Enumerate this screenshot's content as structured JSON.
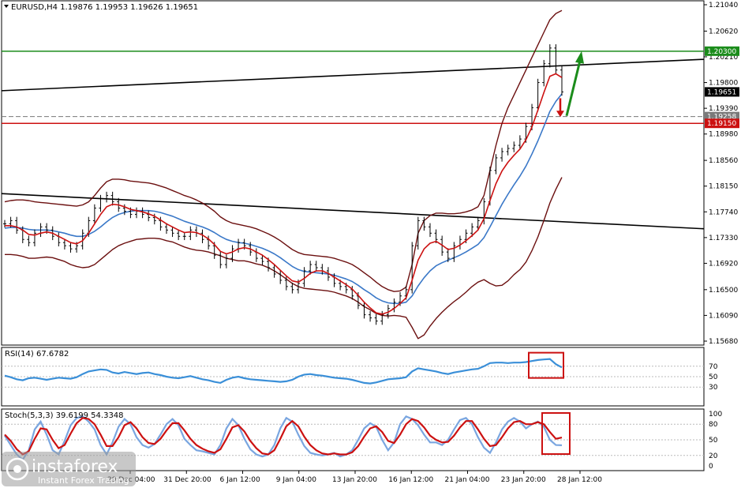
{
  "window": {
    "header": "EURUSD,H4  1.19876 1.19953 1.19626 1.19651",
    "rsi_label": "RSI(14) 67.6782",
    "stoch_label": "Stoch(5,3,3) 39.6199 54.3348"
  },
  "logo": {
    "brand": "instaforex",
    "tagline": "Instant Forex Trading"
  },
  "chart_data": [
    {
      "type": "line",
      "title": "EURUSD,H4  1.19876 1.19953 1.19626 1.19651",
      "y_ticks": [
        "1.21040",
        "1.20620",
        "1.20210",
        "1.19800",
        "1.19390",
        "1.18980",
        "1.18560",
        "1.18150",
        "1.17740",
        "1.17330",
        "1.16920",
        "1.16500",
        "1.16090",
        "1.15680"
      ],
      "ylim": [
        1.1568,
        1.2104
      ],
      "x_ticks": [
        "29 Dec 04:00",
        "31 Dec 20:00",
        "6 Jan 12:00",
        "9 Jan 04:00",
        "13 Jan 20:00",
        "16 Jan 12:00",
        "21 Jan 04:00",
        "23 Jan 20:00",
        "28 Jan 12:00"
      ],
      "price_tags": [
        {
          "label": "1.20300",
          "value": 1.203,
          "color": "#1b8c1b"
        },
        {
          "label": "1.19651",
          "value": 1.19651,
          "color": "#000000"
        },
        {
          "label": "1.19258",
          "value": 1.19258,
          "color": "#7a7a7a"
        },
        {
          "label": "1.19150",
          "value": 1.1915,
          "color": "#cc1111"
        }
      ],
      "levels": {
        "green": 1.203,
        "red": 1.1915,
        "gray_dashed": 1.19258
      },
      "trendlines": [
        {
          "from": [
            0,
            1.1967
          ],
          "to": [
            1,
            1.2017
          ]
        },
        {
          "from": [
            0,
            1.1803
          ],
          "to": [
            1,
            1.1747
          ]
        }
      ],
      "colors": {
        "price": "#000000",
        "ma_fast": "#cc1111",
        "ma_slow": "#3a78c8",
        "bands": "#6b0f0f",
        "green_arrow": "#1b8c1b",
        "red_arrow": "#cc1111"
      },
      "series": [
        {
          "values": [
            1.1755,
            1.176,
            1.1745,
            1.173,
            1.1725,
            1.174,
            1.175,
            1.1745,
            1.1735,
            1.1725,
            1.172,
            1.1715,
            1.172,
            1.174,
            1.176,
            1.178,
            1.1795,
            1.18,
            1.179,
            1.178,
            1.1775,
            1.177,
            1.1775,
            1.177,
            1.1765,
            1.176,
            1.175,
            1.1745,
            1.174,
            1.1735,
            1.1735,
            1.1745,
            1.174,
            1.173,
            1.172,
            1.1705,
            1.169,
            1.17,
            1.1715,
            1.1725,
            1.172,
            1.171,
            1.17,
            1.1695,
            1.1685,
            1.1675,
            1.1665,
            1.1655,
            1.165,
            1.166,
            1.168,
            1.169,
            1.1685,
            1.168,
            1.167,
            1.166,
            1.1655,
            1.165,
            1.164,
            1.1625,
            1.161,
            1.1605,
            1.16,
            1.161,
            1.162,
            1.163,
            1.164,
            1.165,
            1.172,
            1.176,
            1.175,
            1.174,
            1.173,
            1.171,
            1.17,
            1.172,
            1.173,
            1.174,
            1.175,
            1.176,
            1.179,
            1.184,
            1.186,
            1.187,
            1.1875,
            1.188,
            1.189,
            1.191,
            1.194,
            1.198,
            1.201,
            1.2035,
            1.2,
            1.19651
          ]
        },
        {
          "values": [
            1.1752,
            1.1752,
            1.175,
            1.1745,
            1.1738,
            1.1737,
            1.174,
            1.1742,
            1.174,
            1.1735,
            1.173,
            1.1725,
            1.1723,
            1.1728,
            1.174,
            1.1755,
            1.177,
            1.1782,
            1.1786,
            1.1785,
            1.1782,
            1.1778,
            1.1776,
            1.1774,
            1.1771,
            1.1767,
            1.1761,
            1.1755,
            1.175,
            1.1745,
            1.1741,
            1.1742,
            1.1741,
            1.1737,
            1.1731,
            1.1722,
            1.1711,
            1.1707,
            1.171,
            1.1715,
            1.1717,
            1.1715,
            1.171,
            1.1705,
            1.1698,
            1.169,
            1.1681,
            1.1672,
            1.1664,
            1.1662,
            1.1668,
            1.1676,
            1.168,
            1.168,
            1.1676,
            1.167,
            1.1664,
            1.1658,
            1.1651,
            1.1641,
            1.163,
            1.1621,
            1.1613,
            1.1611,
            1.1614,
            1.162,
            1.1628,
            1.1637,
            1.1665,
            1.1697,
            1.1715,
            1.1724,
            1.1727,
            1.1721,
            1.1714,
            1.1716,
            1.1721,
            1.1728,
            1.1736,
            1.1745,
            1.1763,
            1.1792,
            1.1819,
            1.1839,
            1.1853,
            1.1864,
            1.1874,
            1.1889,
            1.1909,
            1.1936,
            1.1964,
            1.199,
            1.1994,
            1.1988
          ]
        },
        {
          "values": [
            1.1748,
            1.1749,
            1.1749,
            1.1748,
            1.1746,
            1.1745,
            1.1745,
            1.1745,
            1.1744,
            1.1742,
            1.174,
            1.1737,
            1.1735,
            1.1735,
            1.1738,
            1.1743,
            1.175,
            1.1758,
            1.1765,
            1.177,
            1.1773,
            1.1775,
            1.1776,
            1.1776,
            1.1776,
            1.1775,
            1.1773,
            1.177,
            1.1767,
            1.1763,
            1.1759,
            1.1756,
            1.1753,
            1.175,
            1.1746,
            1.1741,
            1.1735,
            1.173,
            1.1727,
            1.1725,
            1.1724,
            1.1722,
            1.1719,
            1.1716,
            1.1712,
            1.1707,
            1.1701,
            1.1694,
            1.1687,
            1.1682,
            1.1679,
            1.1678,
            1.1677,
            1.1676,
            1.1675,
            1.1673,
            1.167,
            1.1667,
            1.1663,
            1.1657,
            1.165,
            1.1644,
            1.1637,
            1.1632,
            1.1629,
            1.1628,
            1.1628,
            1.163,
            1.164,
            1.1656,
            1.1669,
            1.168,
            1.1688,
            1.1693,
            1.1697,
            1.1701,
            1.1705,
            1.171,
            1.1716,
            1.1722,
            1.1733,
            1.175,
            1.1768,
            1.1786,
            1.1802,
            1.1817,
            1.1831,
            1.1847,
            1.1866,
            1.1887,
            1.191,
            1.1934,
            1.195,
            1.1962
          ]
        },
        {
          "values": [
            1.179,
            1.1792,
            1.1793,
            1.1793,
            1.1792,
            1.179,
            1.1789,
            1.1788,
            1.1787,
            1.1786,
            1.1785,
            1.1784,
            1.1783,
            1.1785,
            1.179,
            1.18,
            1.1812,
            1.1822,
            1.1826,
            1.1826,
            1.1825,
            1.1823,
            1.1822,
            1.1821,
            1.182,
            1.1818,
            1.1815,
            1.1812,
            1.1808,
            1.1804,
            1.18,
            1.1797,
            1.1793,
            1.1788,
            1.1782,
            1.1775,
            1.1766,
            1.176,
            1.1756,
            1.1754,
            1.1752,
            1.175,
            1.1747,
            1.1743,
            1.1739,
            1.1734,
            1.1728,
            1.1721,
            1.1714,
            1.1709,
            1.1706,
            1.1705,
            1.1704,
            1.1703,
            1.1702,
            1.17,
            1.1697,
            1.1694,
            1.169,
            1.1684,
            1.1677,
            1.167,
            1.1662,
            1.1655,
            1.165,
            1.1647,
            1.1648,
            1.1654,
            1.169,
            1.174,
            1.176,
            1.1768,
            1.1772,
            1.1772,
            1.1771,
            1.1771,
            1.1772,
            1.1774,
            1.1777,
            1.1782,
            1.18,
            1.184,
            1.188,
            1.1915,
            1.194,
            1.196,
            1.198,
            1.2,
            1.202,
            1.204,
            1.206,
            1.208,
            1.209,
            1.2095
          ]
        },
        {
          "values": [
            1.1706,
            1.1706,
            1.1705,
            1.1703,
            1.17,
            1.17,
            1.1701,
            1.1702,
            1.1701,
            1.1698,
            1.1695,
            1.169,
            1.1687,
            1.1685,
            1.1686,
            1.169,
            1.1698,
            1.1706,
            1.1714,
            1.172,
            1.1724,
            1.1727,
            1.173,
            1.1731,
            1.1732,
            1.1732,
            1.1731,
            1.1728,
            1.1726,
            1.1722,
            1.1718,
            1.1715,
            1.1713,
            1.1712,
            1.171,
            1.1707,
            1.1704,
            1.17,
            1.1698,
            1.1696,
            1.1696,
            1.1694,
            1.1691,
            1.1689,
            1.1685,
            1.168,
            1.1674,
            1.1667,
            1.166,
            1.1655,
            1.1652,
            1.1651,
            1.165,
            1.1649,
            1.1648,
            1.1646,
            1.1643,
            1.164,
            1.1636,
            1.163,
            1.1623,
            1.1618,
            1.1612,
            1.1609,
            1.1608,
            1.1609,
            1.1608,
            1.1606,
            1.159,
            1.1572,
            1.1578,
            1.1592,
            1.1604,
            1.1614,
            1.1623,
            1.1631,
            1.1638,
            1.1646,
            1.1655,
            1.1662,
            1.1666,
            1.166,
            1.1656,
            1.1657,
            1.1664,
            1.1674,
            1.1682,
            1.1694,
            1.1712,
            1.1734,
            1.176,
            1.1788,
            1.181,
            1.1829
          ]
        }
      ]
    },
    {
      "type": "line",
      "title": "RSI(14) 67.6782",
      "ylim": [
        0,
        100
      ],
      "y_ticks": [
        "70",
        "50",
        "30"
      ],
      "levels": [
        70,
        50,
        30
      ],
      "series": [
        {
          "values": [
            52,
            49,
            45,
            43,
            47,
            48,
            46,
            44,
            46,
            48,
            47,
            46,
            49,
            55,
            60,
            62,
            64,
            63,
            58,
            56,
            59,
            57,
            55,
            57,
            58,
            55,
            53,
            50,
            48,
            47,
            49,
            51,
            48,
            45,
            43,
            40,
            38,
            44,
            48,
            50,
            47,
            45,
            44,
            43,
            42,
            41,
            40,
            41,
            44,
            50,
            54,
            55,
            53,
            52,
            50,
            48,
            47,
            46,
            44,
            41,
            38,
            37,
            39,
            42,
            45,
            46,
            47,
            49,
            60,
            66,
            64,
            62,
            60,
            57,
            55,
            58,
            60,
            62,
            64,
            65,
            70,
            76,
            77,
            77,
            76,
            77,
            77,
            78,
            80,
            82,
            83,
            84,
            74,
            67.6782
          ]
        }
      ]
    },
    {
      "type": "line",
      "title": "Stoch(5,3,3) 39.6199 54.3348",
      "ylim": [
        0,
        100
      ],
      "y_ticks": [
        "100",
        "80",
        "50",
        "20",
        "0"
      ],
      "levels": [
        80,
        50,
        20
      ],
      "series": [
        {
          "values": [
            58,
            40,
            22,
            12,
            30,
            70,
            85,
            60,
            30,
            22,
            48,
            78,
            92,
            95,
            85,
            70,
            40,
            22,
            45,
            75,
            90,
            80,
            55,
            40,
            35,
            42,
            60,
            80,
            90,
            78,
            52,
            40,
            30,
            28,
            25,
            22,
            40,
            72,
            90,
            78,
            52,
            32,
            22,
            18,
            22,
            40,
            72,
            92,
            85,
            60,
            38,
            25,
            22,
            20,
            22,
            25,
            18,
            22,
            30,
            50,
            72,
            82,
            75,
            50,
            30,
            45,
            80,
            95,
            90,
            78,
            60,
            45,
            45,
            40,
            50,
            70,
            88,
            92,
            80,
            55,
            35,
            25,
            45,
            70,
            85,
            92,
            85,
            72,
            80,
            85,
            75,
            50,
            40,
            39.6199
          ]
        },
        {
          "values": [
            60,
            48,
            32,
            22,
            28,
            52,
            72,
            70,
            50,
            34,
            40,
            62,
            82,
            92,
            90,
            80,
            60,
            38,
            38,
            55,
            78,
            84,
            72,
            55,
            44,
            42,
            52,
            68,
            82,
            82,
            68,
            52,
            40,
            33,
            28,
            25,
            32,
            52,
            74,
            78,
            66,
            48,
            34,
            24,
            22,
            30,
            52,
            76,
            86,
            76,
            56,
            40,
            30,
            24,
            22,
            24,
            22,
            22,
            26,
            38,
            56,
            72,
            76,
            65,
            48,
            44,
            60,
            80,
            90,
            86,
            74,
            58,
            50,
            45,
            46,
            58,
            74,
            86,
            86,
            70,
            52,
            38,
            40,
            55,
            72,
            84,
            86,
            80,
            80,
            84,
            80,
            65,
            52,
            54.3348
          ]
        }
      ]
    }
  ]
}
